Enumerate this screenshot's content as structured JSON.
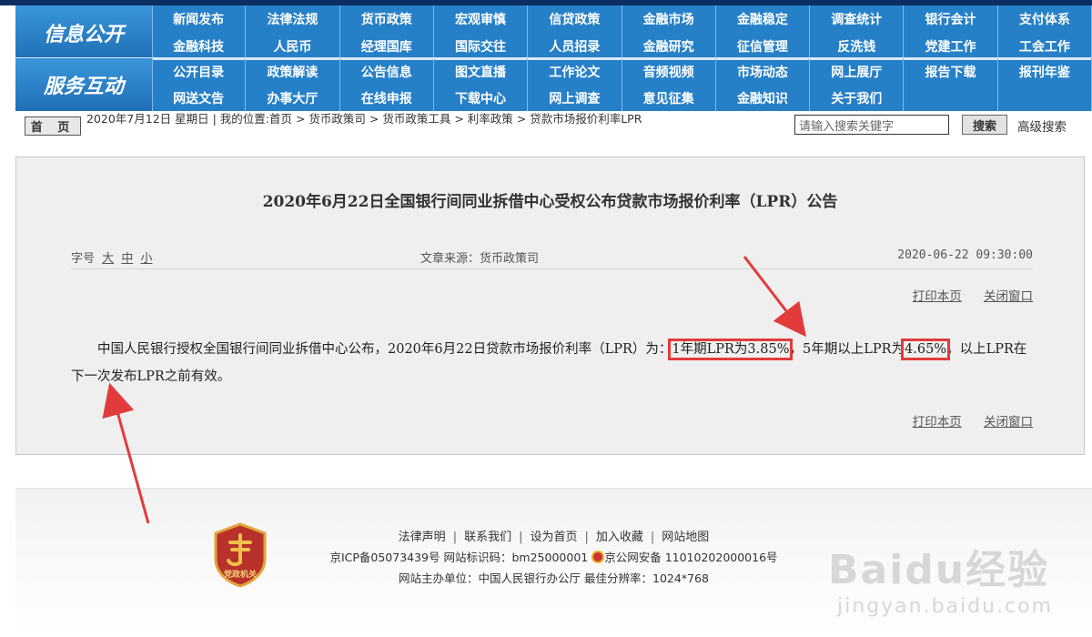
{
  "nav": {
    "section1_title": "信息公开",
    "section2_title": "服务互动",
    "group1": [
      "新闻发布",
      "法律法规",
      "货币政策",
      "宏观审慎",
      "信贷政策",
      "金融市场",
      "金融稳定",
      "调查统计",
      "银行会计",
      "支付体系",
      "金融科技",
      "人民币",
      "经理国库",
      "国际交往",
      "人员招录",
      "金融研究",
      "征信管理",
      "反洗钱",
      "党建工作",
      "工会工作"
    ],
    "group2": [
      "公开目录",
      "政策解读",
      "公告信息",
      "图文直播",
      "工作论文",
      "音频视频",
      "市场动态",
      "网上展厅",
      "报告下载",
      "报刊年鉴",
      "网送文告",
      "办事大厅",
      "在线申报",
      "下载中心",
      "网上调查",
      "意见征集",
      "金融知识",
      "关于我们",
      "",
      ""
    ]
  },
  "breadcrumb": {
    "home_label": "首 页",
    "text": "2020年7月12日 星期日 | 我的位置:首页 > 货币政策司 > 货币政策工具 > 利率政策 > 贷款市场报价利率LPR"
  },
  "search": {
    "placeholder": "请输入搜索关键字",
    "button_label": "搜索",
    "advanced_label": "高级搜索"
  },
  "article": {
    "title": "2020年6月22日全国银行间同业拆借中心受权公布贷款市场报价利率（LPR）公告",
    "font_label": "字号",
    "font_large": "大",
    "font_medium": "中",
    "font_small": "小",
    "source": "文章来源：货币政策司",
    "date": "2020-06-22 09:30:00",
    "print_label": "打印本页",
    "close_label": "关闭窗口",
    "body_part1": "中国人民银行授权全国银行间同业拆借中心公布，2020年6月22日贷款市场报价利率（LPR）为：",
    "body_hl1": "1年期LPR为3.85%",
    "body_part2": "，5年期以上LPR为",
    "body_hl2": "4.65%",
    "body_part3": "。以上LPR在下一次发布LPR之前有效。"
  },
  "footer": {
    "links": [
      "法律声明",
      "联系我们",
      "设为首页",
      "加入收藏",
      "网站地图"
    ],
    "icp": "京ICP备05073439号  网站标识码：bm25000001",
    "police": "京公网安备 11010202000016号",
    "host": "网站主办单位：中国人民银行办公厅   最佳分辨率：1024*768",
    "badge_text": "党政机关"
  },
  "watermark": {
    "brand": "Baidu经验",
    "url": "jingyan.baidu.com"
  },
  "colors": {
    "nav_blue": "#2680c8",
    "top_strip": "#0c2e63",
    "highlight": "#e23b3b"
  }
}
